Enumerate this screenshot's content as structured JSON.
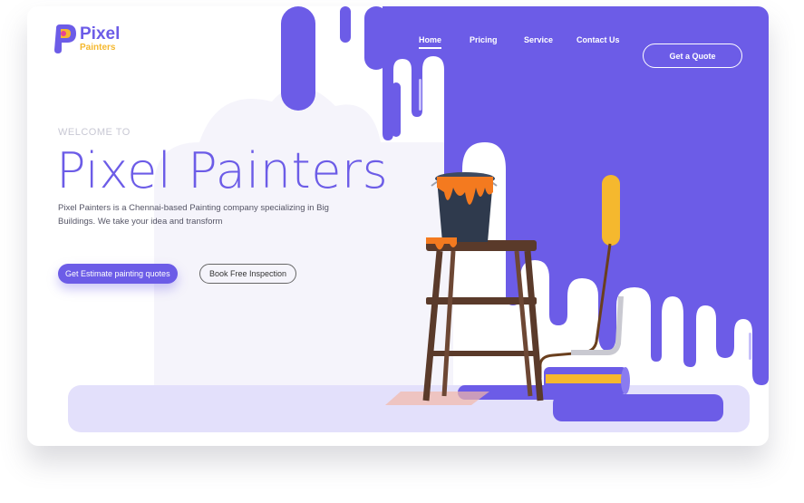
{
  "brand": {
    "name": "Pixel",
    "sub": "Painters",
    "color": "#6c5ce7",
    "accent": "#f5b82e"
  },
  "nav": {
    "items": [
      {
        "label": "Home",
        "active": true
      },
      {
        "label": "Pricing"
      },
      {
        "label": "Service"
      },
      {
        "label": "Contact Us"
      }
    ],
    "cta": "Get a Quote"
  },
  "hero": {
    "welcome": "WELCOME TO",
    "title": "Pixel Painters",
    "description": "Pixel Painters is a Chennai-based Painting company specializing in Big Buildings. We take your idea and transform",
    "primary_button": "Get Estimate painting quotes",
    "secondary_button": "Book Free Inspection"
  },
  "colors": {
    "purple": "#6c5ce7",
    "orange": "#f47a1f",
    "dark": "#5a3a2a"
  },
  "icons": [
    "logo-mark",
    "paint-bucket",
    "stool",
    "paint-roller"
  ]
}
